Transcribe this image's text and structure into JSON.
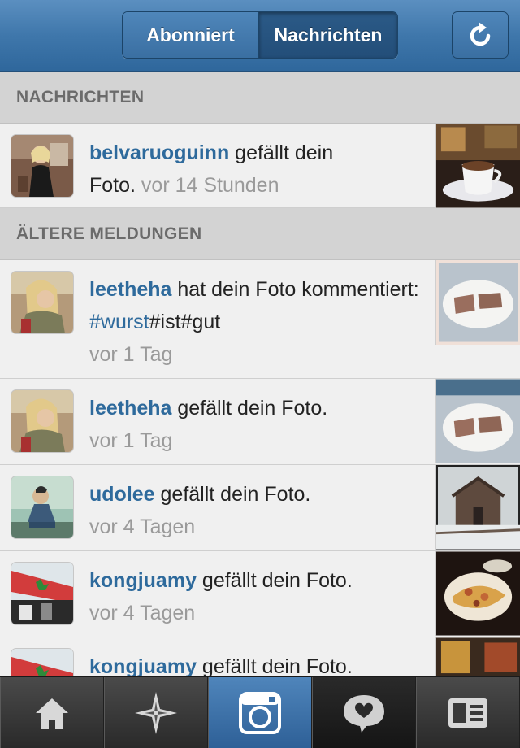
{
  "header": {
    "tab_following": "Abonniert",
    "tab_news": "Nachrichten",
    "refresh_icon": "refresh-icon"
  },
  "sections": {
    "news_title": "NACHRICHTEN",
    "older_title": "ÄLTERE MELDUNGEN"
  },
  "news": [
    {
      "user": "belvaruoguinn",
      "text_before": " gefällt dein ",
      "text_after": "Foto. ",
      "time": "vor 14 Stunden"
    }
  ],
  "older": [
    {
      "user": "leetheha",
      "text": " hat dein Foto kommentiert: ",
      "hashtag": "#wurst",
      "rest": "#ist#gut",
      "time": "vor 1 Tag"
    },
    {
      "user": "leetheha",
      "text": " gefällt dein Foto.",
      "time": "vor 1 Tag"
    },
    {
      "user": "udolee",
      "text": " gefällt dein Foto.",
      "time": "vor 4 Tagen"
    },
    {
      "user": "kongjuamy",
      "text": " gefällt dein Foto.",
      "time": "vor 4 Tagen"
    },
    {
      "user": "kongjuamy",
      "text": " gefällt dein Foto.",
      "time": ""
    }
  ],
  "tabbar": {
    "items": [
      "home-icon",
      "explore-icon",
      "camera-icon",
      "news-icon",
      "profile-icon"
    ],
    "active": "camera-icon"
  },
  "colors": {
    "header_blue": "#3f77ab",
    "username_blue": "#2e6a9c",
    "timestamp_gray": "#9a9a9a",
    "section_gray": "#d3d3d3"
  }
}
